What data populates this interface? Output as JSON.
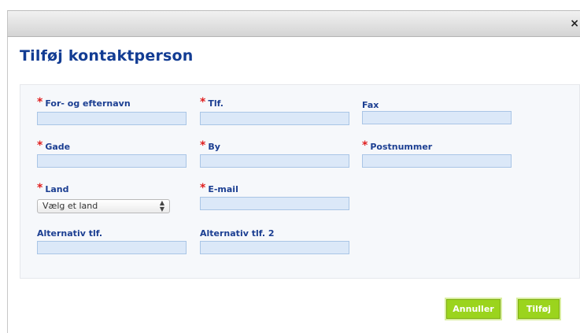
{
  "dialog": {
    "close_label": "×",
    "title": "Tilføj kontaktperson"
  },
  "form": {
    "required_mark": "*",
    "name_label": "For- og efternavn",
    "name_value": "",
    "phone_label": "Tlf.",
    "phone_value": "",
    "fax_label": "Fax",
    "fax_value": "",
    "street_label": "Gade",
    "street_value": "",
    "city_label": "By",
    "city_value": "",
    "postal_label": "Postnummer",
    "postal_value": "",
    "country_label": "Land",
    "country_selected": "Vælg et land",
    "email_label": "E-mail",
    "email_value": "",
    "alt_phone_label": "Alternativ tlf.",
    "alt_phone_value": "",
    "alt_phone2_label": "Alternativ tlf. 2",
    "alt_phone2_value": ""
  },
  "buttons": {
    "cancel": "Annuller",
    "add": "Tilføj"
  },
  "colors": {
    "title": "#123c93",
    "label": "#1c3f92",
    "required": "#e02020",
    "input_bg": "#dbe8f8",
    "button": "#9bd41d"
  }
}
